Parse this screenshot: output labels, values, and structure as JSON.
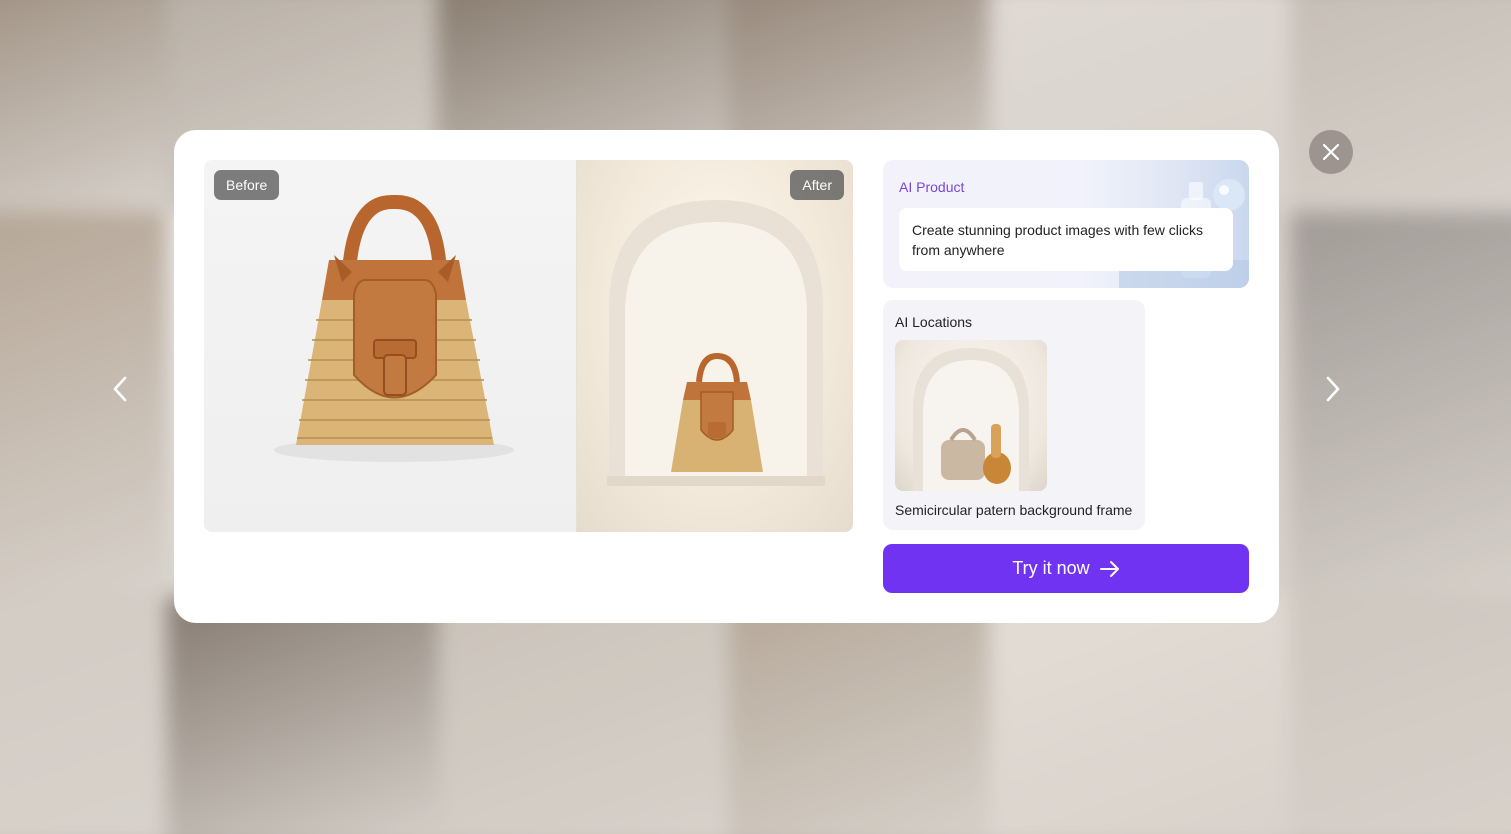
{
  "background": {
    "tiles": [
      "#8a7968",
      "#a89e92",
      "#6d5e4f",
      "#7e6c5c",
      "#d9d2cb",
      "#b9b0a6",
      "#a59380",
      "#e8e3de",
      "#c8bfb4",
      "#ddd6cf",
      "#cec5bb",
      "#8d8680",
      "#c9c1b8",
      "#6b5e52",
      "#bfb6ab",
      "#a59583",
      "#ded6cd",
      "#c3bbb2"
    ]
  },
  "modal": {
    "before_label": "Before",
    "after_label": "After",
    "product": {
      "title": "AI Product",
      "description": "Create stunning product images with few clicks from anywhere"
    },
    "locations": {
      "title": "AI Locations",
      "caption": "Semicircular patern background frame"
    },
    "cta_label": "Try it now"
  },
  "colors": {
    "accent": "#7133f2",
    "product_title": "#7a45d6"
  },
  "icons": {
    "close": "close-icon",
    "prev": "chevron-left-icon",
    "next": "chevron-right-icon",
    "cta": "arrow-right-icon"
  }
}
